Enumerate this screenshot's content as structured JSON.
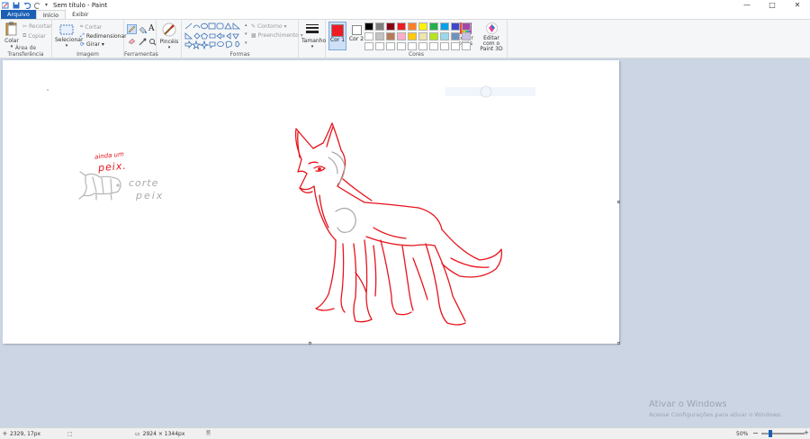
{
  "window": {
    "title": "Sem título - Paint",
    "minimize": "—",
    "maximize": "□",
    "close": "✕"
  },
  "tabs": {
    "file": "Arquivo",
    "home": "Início",
    "view": "Exibir"
  },
  "clipboard": {
    "paste": "Colar",
    "cut": "Recortar",
    "copy": "Copiar",
    "label": "Área de Transferência"
  },
  "image": {
    "select": "Selecionar",
    "crop": "Cortar",
    "resize": "Redimensionar",
    "rotate": "Girar ▾",
    "label": "Imagem"
  },
  "tools": {
    "label": "Ferramentas",
    "text_glyph": "A"
  },
  "brushes": {
    "label": "Pincéis"
  },
  "shapes": {
    "outline": "Contorno ▾",
    "fill": "Preenchimento ▾",
    "label": "Formas"
  },
  "size": {
    "label": "Tamanho"
  },
  "colors": {
    "color1": "Cor 1",
    "color2": "Cor 2",
    "edit": "Editar cores",
    "paint3d": "Editar com o Paint 3D",
    "label": "Cores",
    "color1_value": "#ed1c24",
    "color2_value": "#ffffff",
    "palette": [
      "#000000",
      "#7f7f7f",
      "#880015",
      "#ed1c24",
      "#ff7f27",
      "#fff200",
      "#22b14c",
      "#00a2e8",
      "#3f48cc",
      "#a349a4",
      "#ffffff",
      "#c3c3c3",
      "#b97a57",
      "#ffaec9",
      "#ffc90e",
      "#efe4b0",
      "#b5e61d",
      "#99d9ea",
      "#7092be",
      "#c8bfe7",
      "#ffffff",
      "#ffffff",
      "#ffffff",
      "#ffffff",
      "#ffffff",
      "#ffffff",
      "#ffffff",
      "#ffffff",
      "#ffffff",
      "#ffffff"
    ]
  },
  "canvas": {
    "sketch_text_1": "ainda um",
    "sketch_text_2": "peix.",
    "sketch_text_3": "corte",
    "sketch_text_4": "peix"
  },
  "status": {
    "cursor": "2329, 17px",
    "size": "2924 × 1344px",
    "zoom": "50%"
  },
  "watermark": {
    "title": "Ativar o Windows",
    "subtitle": "Acesse Configurações para ativar o Windows."
  }
}
